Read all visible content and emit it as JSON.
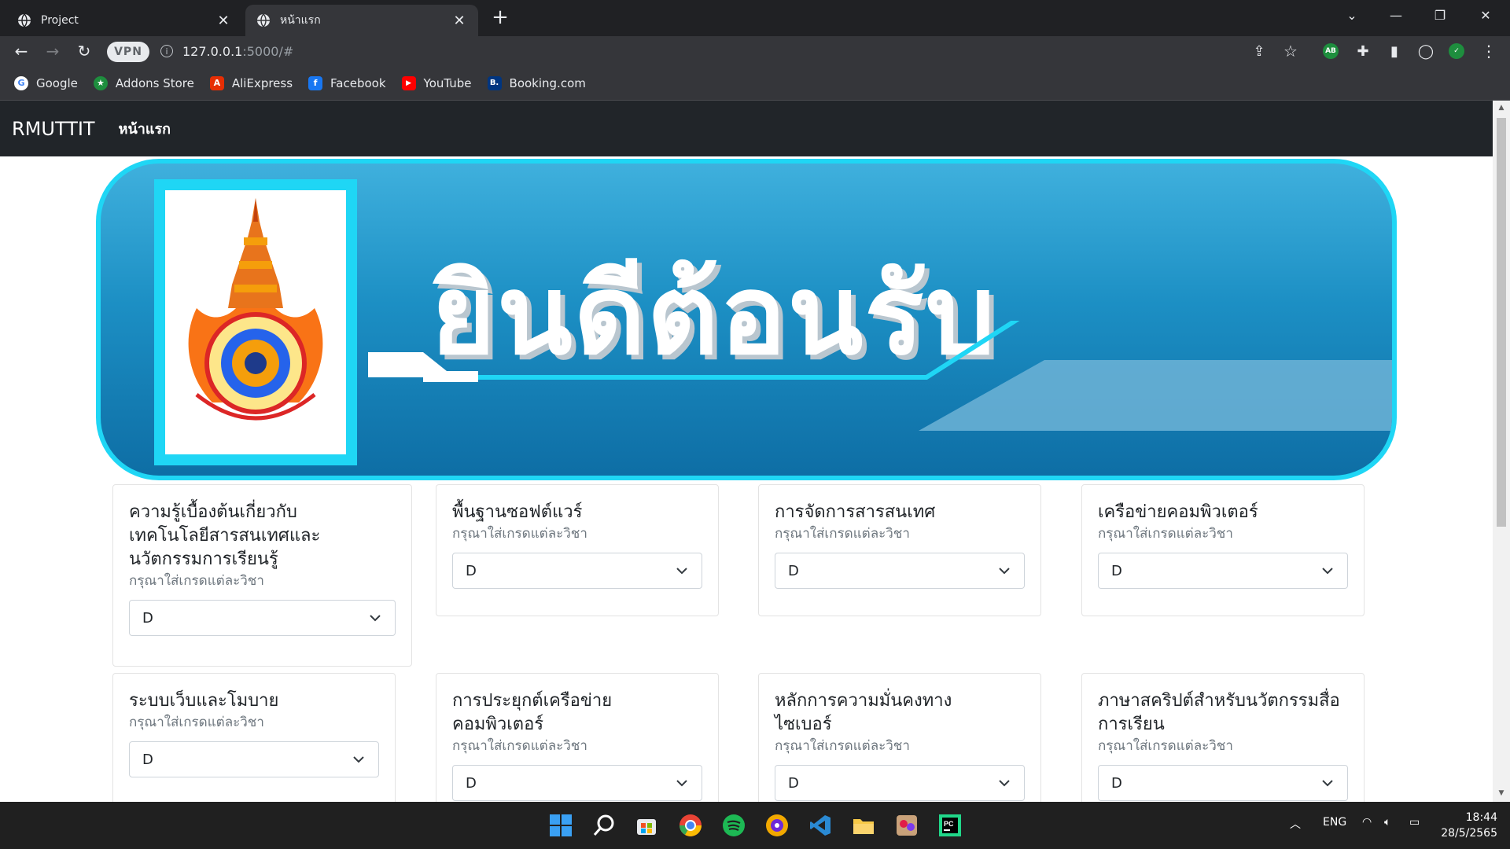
{
  "browser": {
    "tabs": [
      {
        "title": "Project",
        "active": false
      },
      {
        "title": "หน้าแรก",
        "active": true
      }
    ],
    "url_host": "127.0.0.1",
    "url_rest": ":5000/#",
    "vpn_label": "VPN",
    "extensions": [
      {
        "name": "adblock-extension",
        "label": "AB",
        "color": "#1e8e3e"
      },
      {
        "name": "verified-extension",
        "label": "✓",
        "color": "#1e8e3e"
      }
    ],
    "bookmarks": [
      {
        "label": "Google",
        "icon": "google-icon",
        "color": "#ffffff",
        "glyph": "G",
        "glyph_color": "#4285f4"
      },
      {
        "label": "Addons Store",
        "icon": "addons-store-icon",
        "color": "#1e8e3e",
        "glyph": "★",
        "glyph_color": "#ffffff"
      },
      {
        "label": "AliExpress",
        "icon": "aliexpress-icon",
        "color": "#e62e04",
        "glyph": "A",
        "glyph_color": "#ffffff"
      },
      {
        "label": "Facebook",
        "icon": "facebook-icon",
        "color": "#1877f2",
        "glyph": "f",
        "glyph_color": "#ffffff"
      },
      {
        "label": "YouTube",
        "icon": "youtube-icon",
        "color": "#ff0000",
        "glyph": "▶",
        "glyph_color": "#ffffff"
      },
      {
        "label": "Booking.com",
        "icon": "booking-icon",
        "color": "#003580",
        "glyph": "B.",
        "glyph_color": "#ffffff"
      }
    ]
  },
  "page": {
    "brand": "RMUTTIT",
    "nav_home": "หน้าแรก",
    "banner_text": "ยินดีต้อนรับ",
    "courses": [
      {
        "title": "ความรู้เบื้องต้นเกี่ยวกับเทคโนโลยีสารสนเทศและนวัตกรรมการเรียนรู้",
        "hint": "กรุณาใส่เกรดแต่ละวิชา",
        "grade": "D"
      },
      {
        "title": "พื้นฐานซอฟต์แวร์",
        "hint": "กรุณาใส่เกรดแต่ละวิชา",
        "grade": "D"
      },
      {
        "title": "การจัดการสารสนเทศ",
        "hint": "กรุณาใส่เกรดแต่ละวิชา",
        "grade": "D"
      },
      {
        "title": "เครือข่ายคอมพิวเตอร์",
        "hint": "กรุณาใส่เกรดแต่ละวิชา",
        "grade": "D"
      },
      {
        "title": "ระบบเว็บและโมบาย",
        "hint": "กรุณาใส่เกรดแต่ละวิชา",
        "grade": "D"
      },
      {
        "title": "การประยุกต์เครือข่ายคอมพิวเตอร์",
        "hint": "กรุณาใส่เกรดแต่ละวิชา",
        "grade": "D"
      },
      {
        "title": "หลักการความมั่นคงทางไซเบอร์",
        "hint": "กรุณาใส่เกรดแต่ละวิชา",
        "grade": "D"
      },
      {
        "title": "ภาษาสคริปต์สำหรับนวัตกรรมสื่อการเรียน",
        "hint": "กรุณาใส่เกรดแต่ละวิชา",
        "grade": "D"
      }
    ]
  },
  "taskbar": {
    "apps": [
      {
        "name": "windows-start-icon",
        "color": "#3aa0f3"
      },
      {
        "name": "search-icon",
        "color": "#202020"
      },
      {
        "name": "store-icon",
        "color": "#4a8fe7"
      },
      {
        "name": "chrome-icon",
        "color": "#e94335"
      },
      {
        "name": "spotify-icon",
        "color": "#1db954"
      },
      {
        "name": "vpn-app-icon",
        "color": "#f2a900"
      },
      {
        "name": "vscode-icon",
        "color": "#2a8ad4"
      },
      {
        "name": "file-explorer-icon",
        "color": "#f7c948"
      },
      {
        "name": "game-app-icon",
        "color": "#c9a27a"
      },
      {
        "name": "pycharm-icon",
        "color": "#21d789"
      }
    ],
    "language": "ENG",
    "time": "18:44",
    "date": "28/5/2565"
  }
}
